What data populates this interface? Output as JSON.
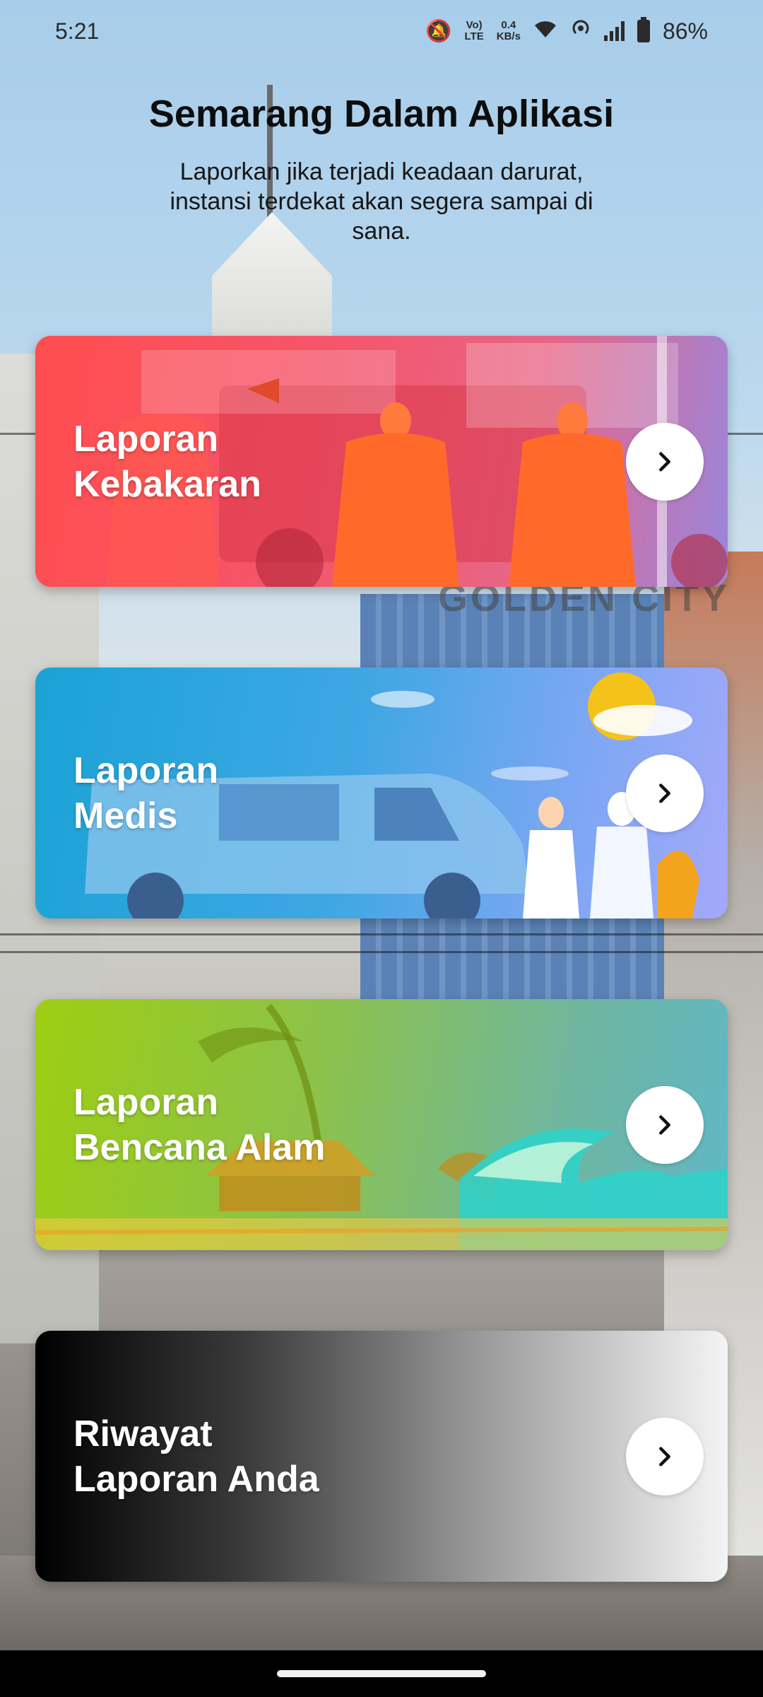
{
  "status_bar": {
    "time": "5:21",
    "volte_top": "Vo)",
    "volte_bottom": "LTE",
    "speed_top": "0.4",
    "speed_bottom": "KB/s",
    "battery": "86%"
  },
  "header": {
    "title": "Semarang Dalam Aplikasi",
    "subtitle": "Laporkan jika terjadi keadaan darurat, instansi terdekat akan segera sampai di sana."
  },
  "background": {
    "sign_text": "GOLDEN CITY"
  },
  "cards": [
    {
      "line1": "Laporan",
      "line2": "Kebakaran"
    },
    {
      "line1": "Laporan",
      "line2": "Medis"
    },
    {
      "line1": "Laporan",
      "line2": "Bencana Alam"
    },
    {
      "line1": "Riwayat",
      "line2": "Laporan Anda"
    }
  ],
  "icons": {
    "status": [
      "mute-icon",
      "volte-icon",
      "wifi-icon",
      "hotspot-icon",
      "signal-icon",
      "battery-icon"
    ],
    "card_action": "chevron-right-icon"
  },
  "colors": {
    "fire_card": "#ff4d4f",
    "medical_card": "#1aa3d6",
    "nature_card": "#9dce13",
    "history_card": "#000000",
    "arrow_button": "#ffffff"
  }
}
